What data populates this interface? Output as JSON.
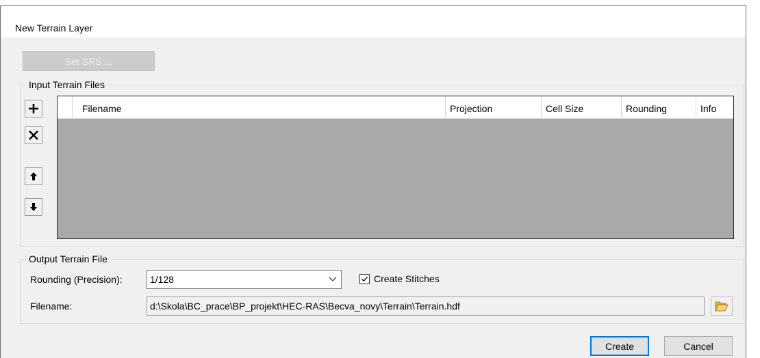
{
  "dialog": {
    "title": "New Terrain Layer"
  },
  "toolbar": {
    "set_srs_label": "Set SRS ..."
  },
  "input_group": {
    "label": "Input Terrain Files",
    "buttons": {
      "add": "add-icon",
      "remove": "close-icon",
      "move_up": "arrow-up-icon",
      "move_down": "arrow-down-icon"
    },
    "columns": [
      "Filename",
      "Projection",
      "Cell Size",
      "Rounding",
      "Info"
    ],
    "rows": []
  },
  "output_group": {
    "label": "Output Terrain File",
    "rounding_label": "Rounding (Precision):",
    "rounding_value": "1/128",
    "create_stitches_label": "Create Stitches",
    "create_stitches_checked": true,
    "filename_label": "Filename:",
    "filename_value": "d:\\Skola\\BC_prace\\BP_projekt\\HEC-RAS\\Becva_novy\\Terrain\\Terrain.hdf",
    "browse_icon": "folder-open-icon"
  },
  "footer": {
    "create_label": "Create",
    "cancel_label": "Cancel"
  },
  "colors": {
    "accent": "#0078d7",
    "grid_bg": "#a9a9a9",
    "dialog_bg": "#f0f0f0"
  }
}
